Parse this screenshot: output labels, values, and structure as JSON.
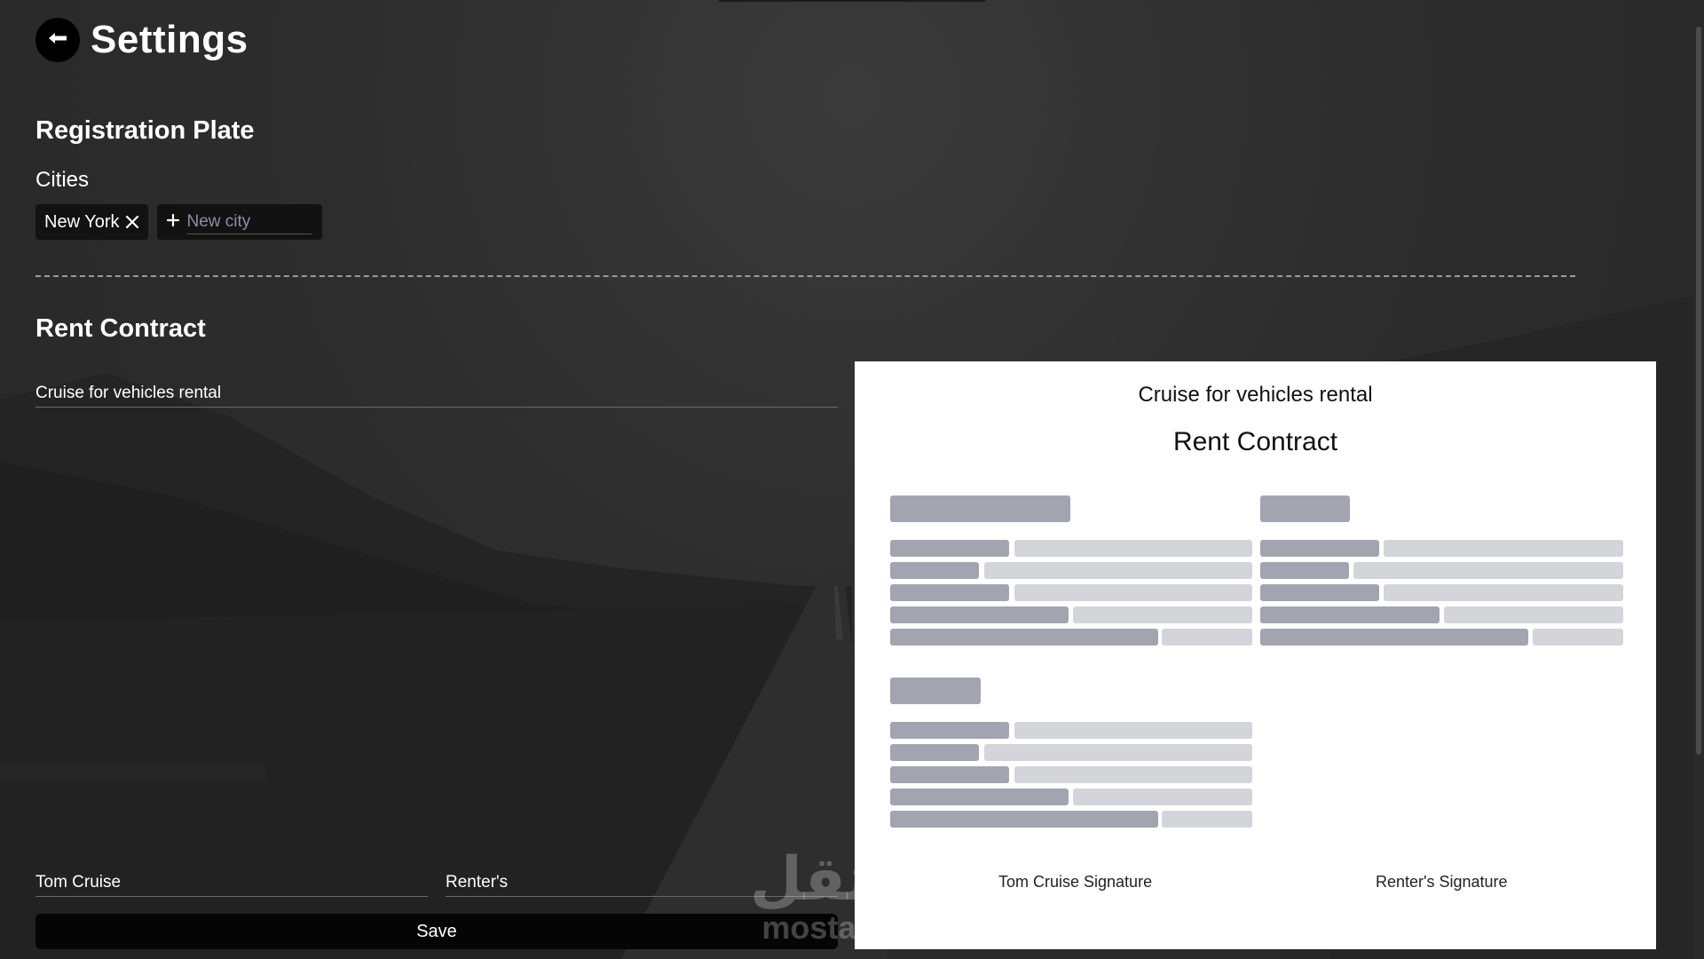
{
  "header": {
    "title": "Settings"
  },
  "registration": {
    "title": "Registration Plate",
    "cities_label": "Cities",
    "cities": [
      "New York"
    ],
    "new_city_placeholder": "New city"
  },
  "rent_contract": {
    "title": "Rent Contract",
    "company_value": "Cruise for vehicles rental",
    "owner_signature_value": "Tom Cruise",
    "renter_signature_value": "Renter's"
  },
  "actions": {
    "save_label": "Save"
  },
  "preview": {
    "company": "Cruise for vehicles rental",
    "title": "Rent Contract",
    "owner_signature": "Tom Cruise Signature",
    "renter_signature": "Renter's Signature"
  },
  "watermark": {
    "arabic": "مستقل",
    "latin": "mostaql.com"
  },
  "icons": {
    "back": "arrow-left-icon",
    "remove": "close-icon",
    "add": "plus-icon"
  },
  "colors": {
    "background": "#2b2b2b",
    "chip": "#121212",
    "placeholder": "#8a8fa6",
    "preview_bar_dark": "#a2a5b0",
    "preview_bar_light": "#d3d5db"
  }
}
